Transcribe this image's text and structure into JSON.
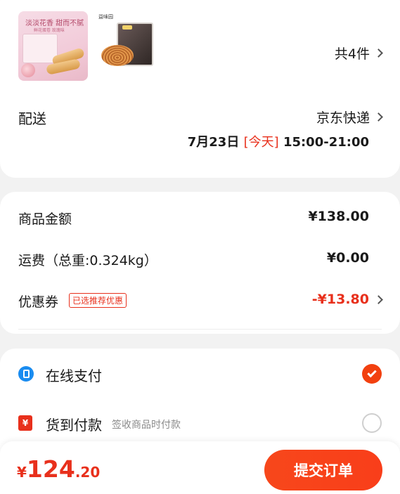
{
  "order": {
    "products": [
      {
        "name": "淡淡花香 甜而不腻",
        "sub": "鲜花蛋卷 玫瑰味"
      },
      {
        "name": "",
        "brand": "益味园"
      }
    ],
    "count_label": "共4件"
  },
  "delivery": {
    "label": "配送",
    "carrier": "京东快递",
    "date": "7月23日",
    "today": "[今天]",
    "time": "15:00-21:00"
  },
  "price": {
    "goods_label": "商品金额",
    "goods_value": "¥138.00",
    "shipping_label": "运费（总重:0.324kg）",
    "shipping_value": "¥0.00",
    "coupon_label": "优惠券",
    "coupon_tag": "已选推荐优惠",
    "coupon_value": "-¥13.80"
  },
  "payment": {
    "online_label": "在线支付",
    "online_selected": true,
    "cod_label": "货到付款",
    "cod_note": "签收商品时付款",
    "cod_selected": false
  },
  "footer": {
    "currency": "¥",
    "total_int": "124",
    "total_dec": ".20",
    "submit_label": "提交订单"
  },
  "colors": {
    "accent": "#e8301c",
    "online_icon": "#1a8cf0",
    "background": "#f2f2f2"
  }
}
